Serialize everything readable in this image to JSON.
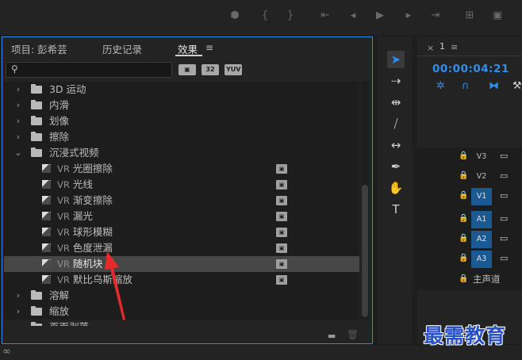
{
  "transport": {
    "icons": [
      "marker-icon",
      "in-point-icon",
      "out-point-icon",
      "go-to-in-icon",
      "step-back-icon",
      "play-icon",
      "step-forward-icon",
      "go-to-out-icon",
      "insert-icon",
      "export-frame-icon"
    ]
  },
  "effects_panel": {
    "tabs": [
      {
        "label": "项目: 彭希芸"
      },
      {
        "label": "历史记录"
      },
      {
        "label": "效果"
      }
    ],
    "menu_glyph": "≡",
    "search": {
      "value": "",
      "placeholder": ""
    },
    "filter_badges": [
      "32",
      "YUV"
    ],
    "tree": [
      {
        "type": "folder",
        "state": "collapsed",
        "label": "3D 运动"
      },
      {
        "type": "folder",
        "state": "collapsed",
        "label": "内滑"
      },
      {
        "type": "folder",
        "state": "collapsed",
        "label": "划像"
      },
      {
        "type": "folder",
        "state": "collapsed",
        "label": "擦除"
      },
      {
        "type": "folder",
        "state": "expanded",
        "label": "沉浸式视频"
      },
      {
        "type": "effect",
        "prefix": "VR",
        "label": "光圈擦除"
      },
      {
        "type": "effect",
        "prefix": "VR",
        "label": "光线"
      },
      {
        "type": "effect",
        "prefix": "VR",
        "label": "渐变擦除"
      },
      {
        "type": "effect",
        "prefix": "VR",
        "label": "漏光"
      },
      {
        "type": "effect",
        "prefix": "VR",
        "label": "球形模糊"
      },
      {
        "type": "effect",
        "prefix": "VR",
        "label": "色度泄漏"
      },
      {
        "type": "effect",
        "prefix": "VR",
        "label": "随机块",
        "selected": true
      },
      {
        "type": "effect",
        "prefix": "VR",
        "label": "默比乌斯缩放"
      },
      {
        "type": "folder",
        "state": "collapsed",
        "label": "溶解"
      },
      {
        "type": "folder",
        "state": "collapsed",
        "label": "缩放"
      },
      {
        "type": "folder",
        "state": "collapsed",
        "label": "页面剥落"
      }
    ]
  },
  "tools": [
    "selection-tool-icon",
    "track-select-tool-icon",
    "ripple-edit-tool-icon",
    "razor-tool-icon",
    "slip-tool-icon",
    "pen-tool-icon",
    "hand-tool-icon",
    "type-tool-icon"
  ],
  "timeline": {
    "close_glyph": "×",
    "sequence_number": "1",
    "menu_glyph": "≡",
    "timecode": "00:00:04:21",
    "tracks": [
      {
        "name": "V3",
        "targeted": false
      },
      {
        "name": "V2",
        "targeted": false
      },
      {
        "name": "V1",
        "targeted": true
      },
      {
        "name": "A1",
        "targeted": true
      },
      {
        "name": "A2",
        "targeted": true
      },
      {
        "name": "A3",
        "targeted": true
      }
    ],
    "master_label": "主声道"
  },
  "colors": {
    "accent": "#2e8ef0",
    "panel_border": "#2d8ceb",
    "track_target": "#1a5a94",
    "annotation_arrow": "#e8292c",
    "watermark": "#2a52c8"
  },
  "watermark": "最需教育"
}
